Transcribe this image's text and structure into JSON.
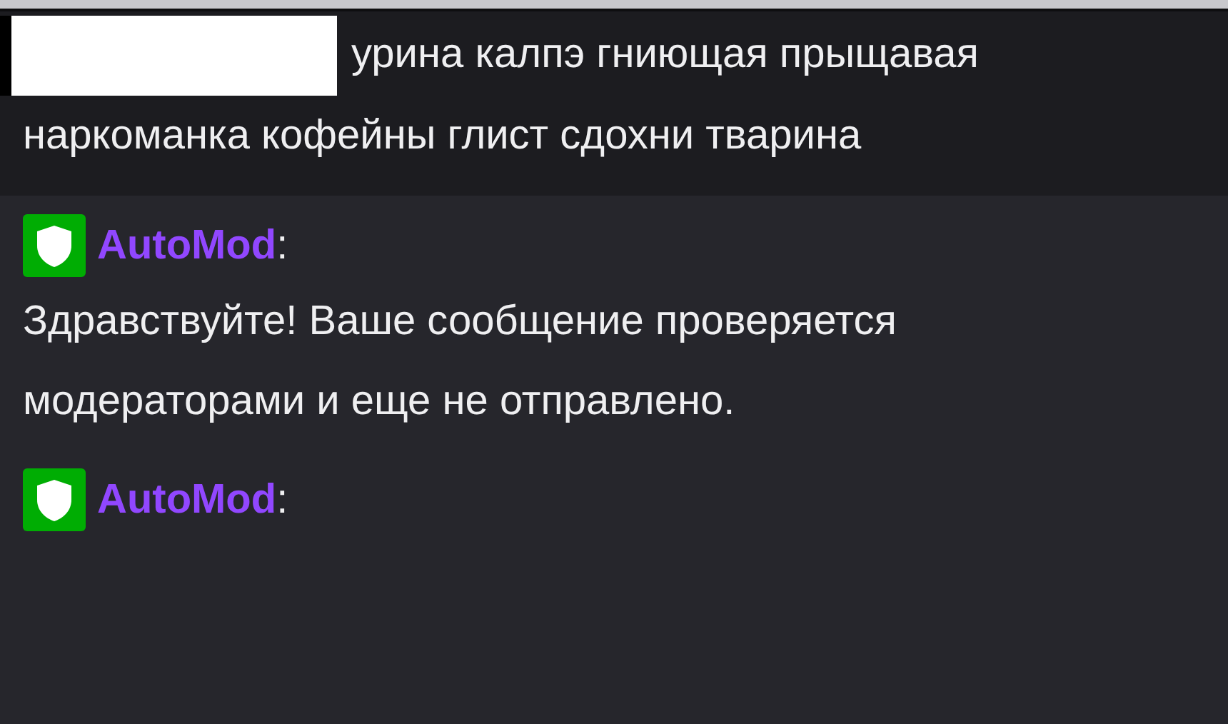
{
  "messages": [
    {
      "kind": "user",
      "name_redacted": true,
      "text": "урина калпэ гниющая прыщавая наркоманка кофейны глист сдохни тварина"
    },
    {
      "kind": "automod",
      "name": "AutoMod",
      "separator": ":",
      "text": "Здравствуйте! Ваше сообщение проверяется модераторами и еще не отправлено."
    },
    {
      "kind": "automod",
      "name": "AutoMod",
      "separator": ":"
    }
  ]
}
